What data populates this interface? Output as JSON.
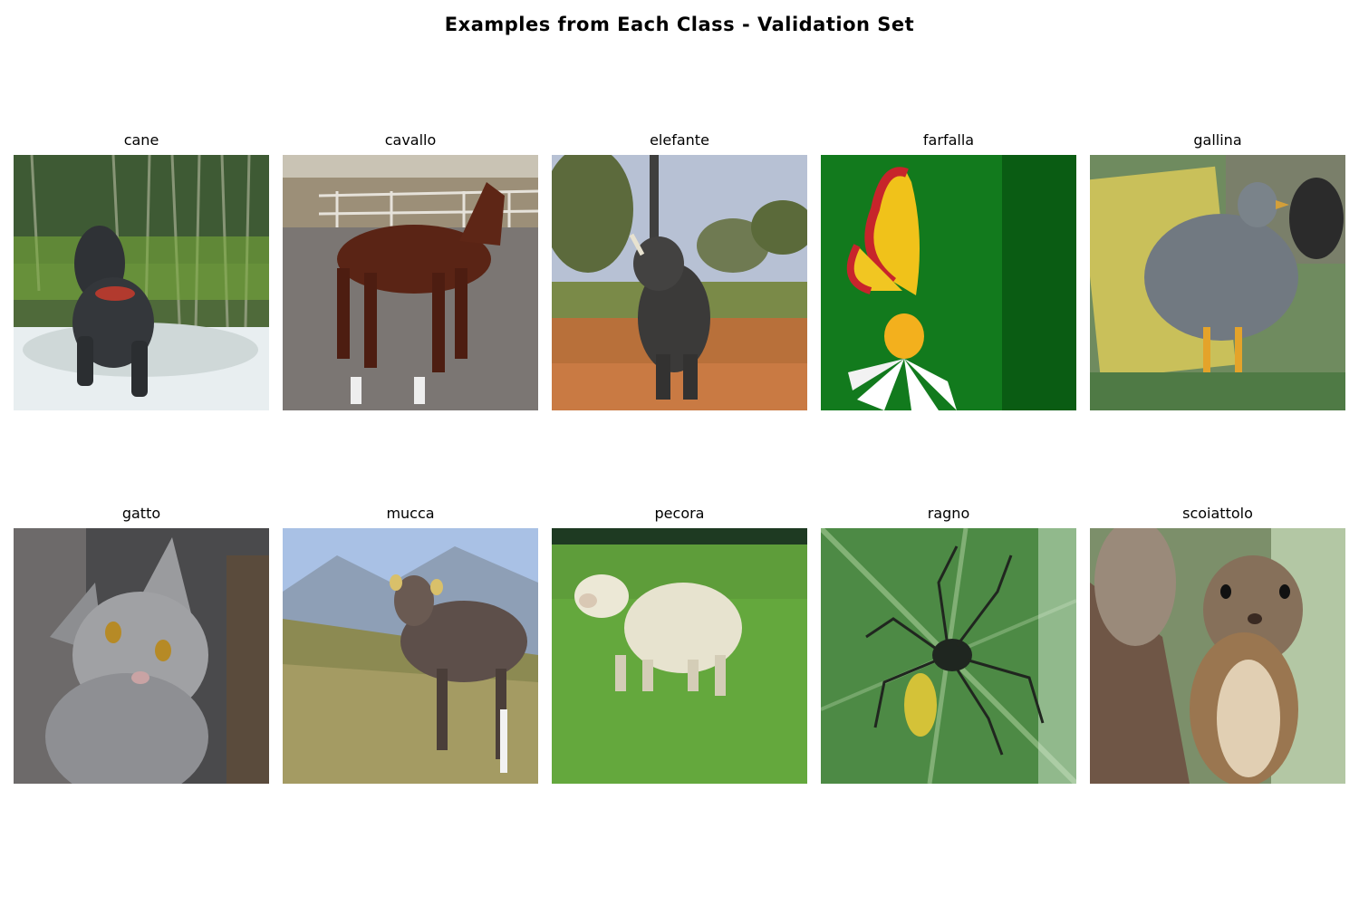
{
  "figure": {
    "title": "Examples from Each Class - Validation Set"
  },
  "rows": [
    [
      {
        "label": "cane",
        "subject": "dog-photo"
      },
      {
        "label": "cavallo",
        "subject": "horse-photo"
      },
      {
        "label": "elefante",
        "subject": "elephant-photo"
      },
      {
        "label": "farfalla",
        "subject": "butterfly-photo"
      },
      {
        "label": "gallina",
        "subject": "hen-photo"
      }
    ],
    [
      {
        "label": "gatto",
        "subject": "cat-photo"
      },
      {
        "label": "mucca",
        "subject": "cow-photo"
      },
      {
        "label": "pecora",
        "subject": "sheep-photo"
      },
      {
        "label": "ragno",
        "subject": "spider-photo"
      },
      {
        "label": "scoiattolo",
        "subject": "squirrel-photo"
      }
    ]
  ]
}
